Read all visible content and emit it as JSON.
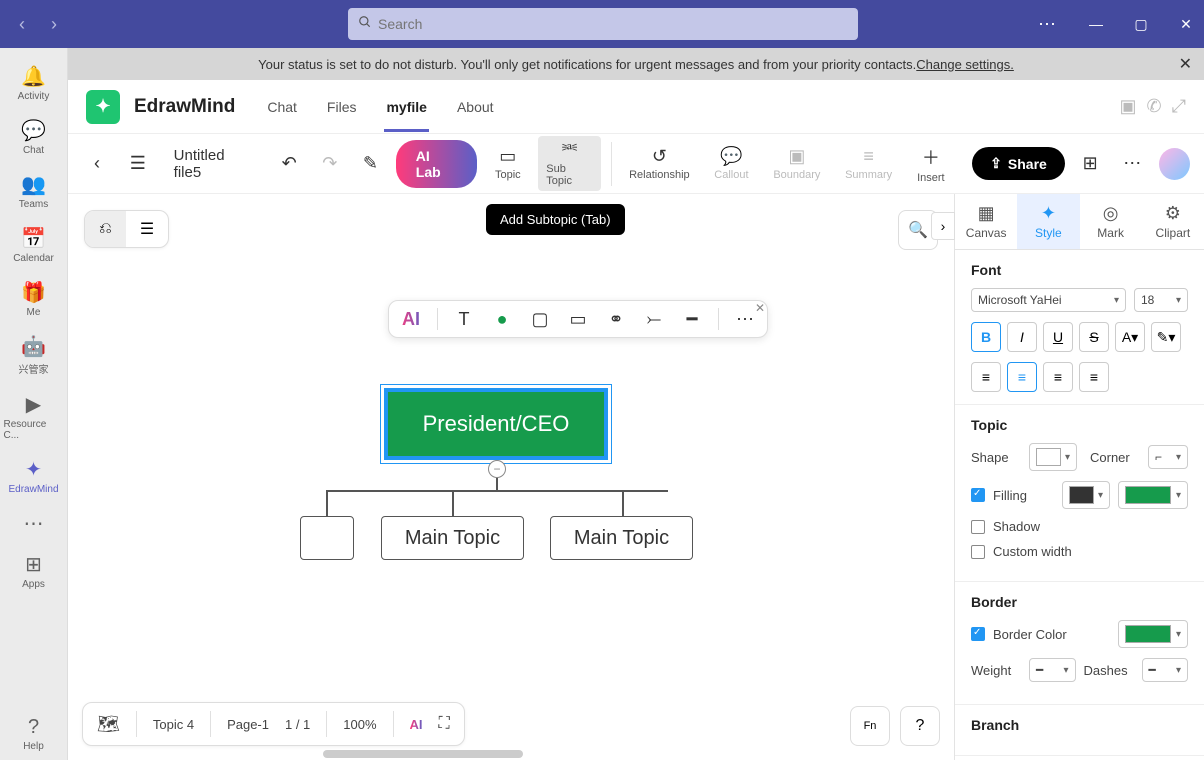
{
  "titlebar": {
    "search_placeholder": "Search"
  },
  "rail": {
    "activity": "Activity",
    "chat": "Chat",
    "teams": "Teams",
    "calendar": "Calendar",
    "me": "Me",
    "xingguanjia": "兴管家",
    "resource": "Resource C...",
    "edrawmind": "EdrawMind",
    "apps": "Apps",
    "help": "Help"
  },
  "banner": {
    "text": "Your status is set to do not disturb. You'll only get notifications for urgent messages and from your priority contacts. ",
    "link": "Change settings."
  },
  "app": {
    "name": "EdrawMind",
    "tabs": {
      "chat": "Chat",
      "files": "Files",
      "myfile": "myfile",
      "about": "About"
    }
  },
  "toolbar": {
    "filename": "Untitled file5",
    "ai_lab": "AI Lab",
    "topic": "Topic",
    "subtopic": "Sub Topic",
    "relationship": "Relationship",
    "callout": "Callout",
    "boundary": "Boundary",
    "summary": "Summary",
    "insert": "Insert",
    "share": "Share"
  },
  "tooltip": {
    "subtopic": "Add Subtopic (Tab)"
  },
  "mindmap": {
    "root": "President/CEO",
    "child1": "",
    "child2": "Main Topic",
    "child3": "Main Topic"
  },
  "style_panel": {
    "tabs": {
      "canvas": "Canvas",
      "style": "Style",
      "mark": "Mark",
      "clipart": "Clipart"
    },
    "font": {
      "title": "Font",
      "family": "Microsoft YaHei",
      "size": "18"
    },
    "topic": {
      "title": "Topic",
      "shape": "Shape",
      "corner": "Corner",
      "filling": "Filling",
      "shadow": "Shadow",
      "custom_width": "Custom width",
      "fill_color": "#169b4c",
      "fill2": "#333333"
    },
    "border": {
      "title": "Border",
      "border_color": "Border Color",
      "color": "#169b4c",
      "weight": "Weight",
      "dashes": "Dashes"
    },
    "branch": {
      "title": "Branch"
    }
  },
  "bottom": {
    "topic": "Topic 4",
    "page": "Page-1",
    "page_num": "1 / 1",
    "zoom": "100%"
  }
}
